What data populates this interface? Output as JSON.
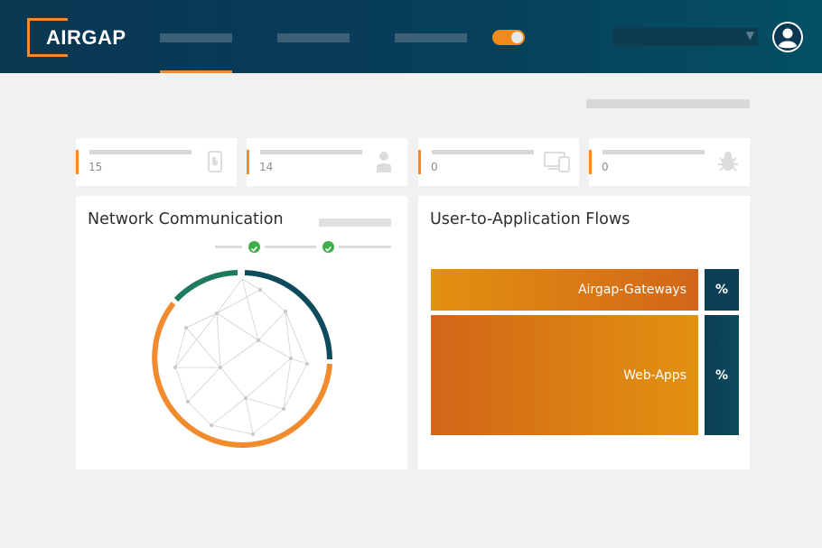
{
  "app": {
    "logo_text": "AIRGAP"
  },
  "header": {
    "nav_items": [
      "",
      "",
      ""
    ],
    "toggle": {
      "state": "on",
      "color": "#f28a1b"
    },
    "select": {
      "value": ""
    }
  },
  "stats": [
    {
      "value": "15",
      "icon": "mobile-device-icon"
    },
    {
      "value": "14",
      "icon": "user-icon"
    },
    {
      "value": "0",
      "icon": "devices-icon"
    },
    {
      "value": "0",
      "icon": "bug-icon"
    }
  ],
  "network_panel": {
    "title": "Network Communication"
  },
  "flows_panel": {
    "title": "User-to-Application Flows",
    "rows": [
      {
        "label": "Airgap-Gateways",
        "pct": "%"
      },
      {
        "label": "Web-Apps",
        "pct": "%"
      }
    ]
  },
  "colors": {
    "accent": "#f28a2e",
    "header_dark": "#0a3752",
    "teal": "#0d4a5c",
    "green_segment": "#1d7a5e",
    "orange_segment": "#f28a2e"
  }
}
